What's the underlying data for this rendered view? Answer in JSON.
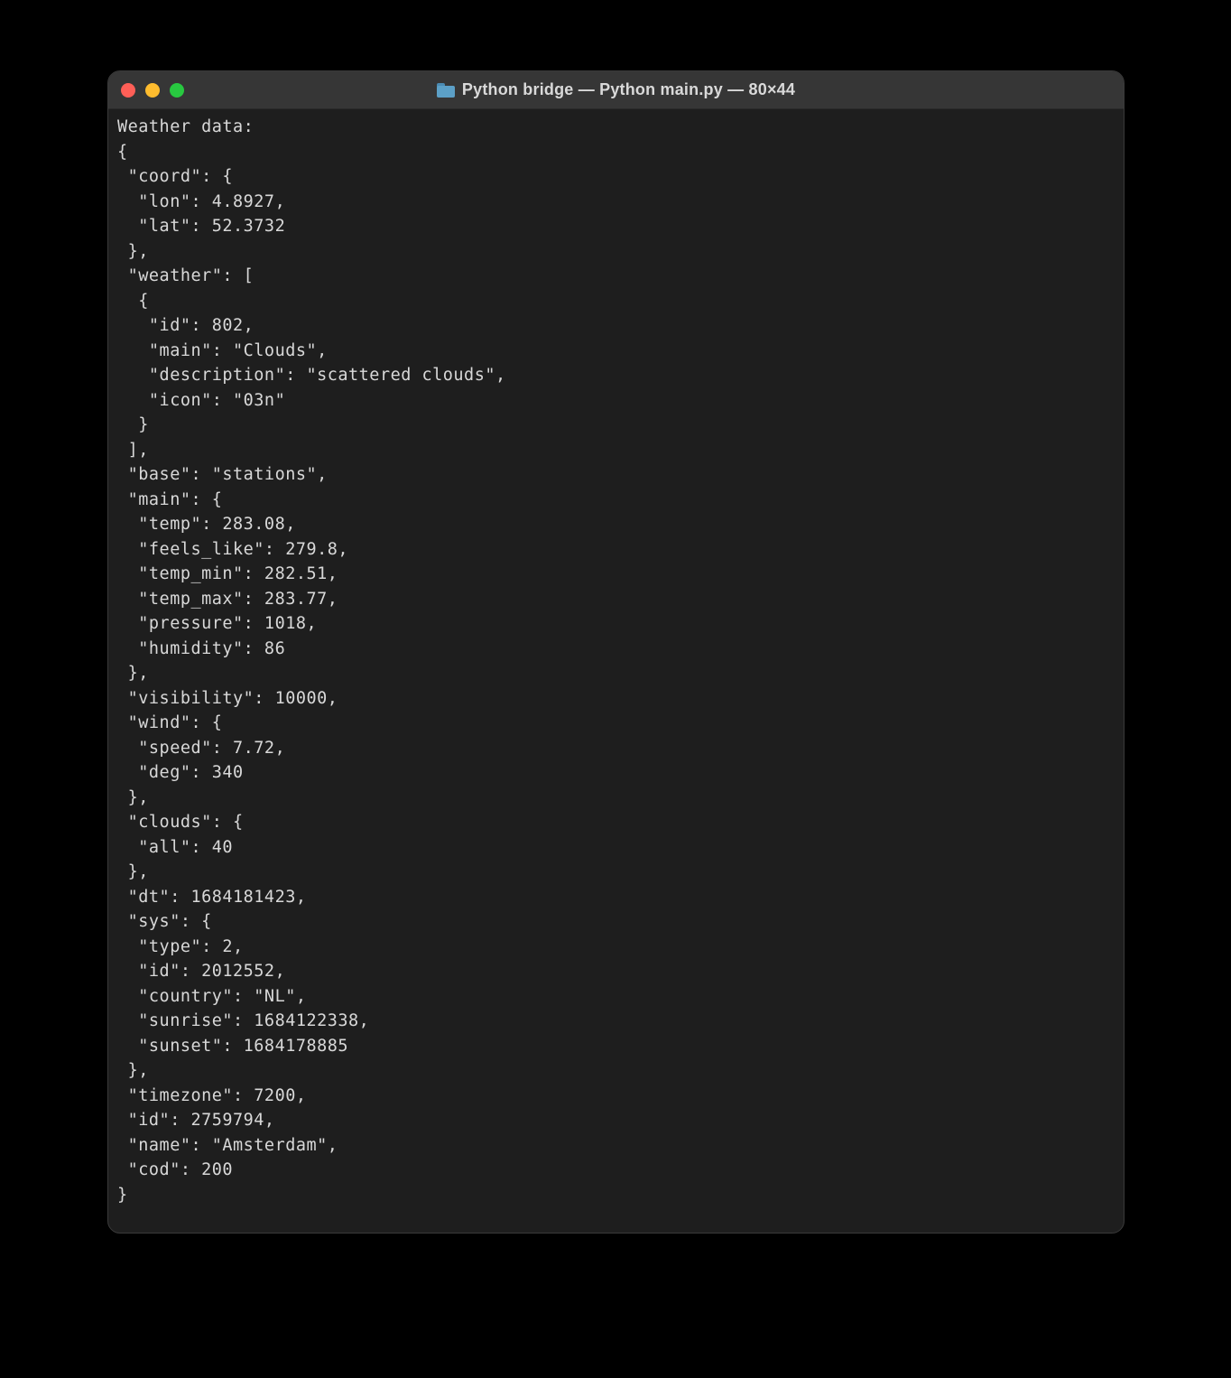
{
  "window": {
    "title": "Python bridge — Python main.py — 80×44"
  },
  "terminal": {
    "lines": [
      "Weather data:",
      "{",
      " \"coord\": {",
      "  \"lon\": 4.8927,",
      "  \"lat\": 52.3732",
      " },",
      " \"weather\": [",
      "  {",
      "   \"id\": 802,",
      "   \"main\": \"Clouds\",",
      "   \"description\": \"scattered clouds\",",
      "   \"icon\": \"03n\"",
      "  }",
      " ],",
      " \"base\": \"stations\",",
      " \"main\": {",
      "  \"temp\": 283.08,",
      "  \"feels_like\": 279.8,",
      "  \"temp_min\": 282.51,",
      "  \"temp_max\": 283.77,",
      "  \"pressure\": 1018,",
      "  \"humidity\": 86",
      " },",
      " \"visibility\": 10000,",
      " \"wind\": {",
      "  \"speed\": 7.72,",
      "  \"deg\": 340",
      " },",
      " \"clouds\": {",
      "  \"all\": 40",
      " },",
      " \"dt\": 1684181423,",
      " \"sys\": {",
      "  \"type\": 2,",
      "  \"id\": 2012552,",
      "  \"country\": \"NL\",",
      "  \"sunrise\": 1684122338,",
      "  \"sunset\": 1684178885",
      " },",
      " \"timezone\": 7200,",
      " \"id\": 2759794,",
      " \"name\": \"Amsterdam\",",
      " \"cod\": 200",
      "}"
    ]
  }
}
